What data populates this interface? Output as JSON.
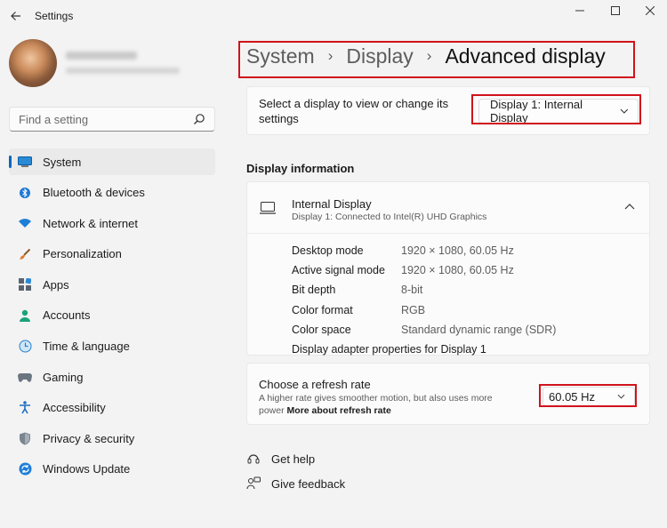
{
  "window": {
    "title": "Settings"
  },
  "search": {
    "placeholder": "Find a setting"
  },
  "sidebar": {
    "items": [
      {
        "label": "System",
        "icon": "system-icon",
        "active": true
      },
      {
        "label": "Bluetooth & devices",
        "icon": "bluetooth-icon"
      },
      {
        "label": "Network & internet",
        "icon": "wifi-icon"
      },
      {
        "label": "Personalization",
        "icon": "brush-icon"
      },
      {
        "label": "Apps",
        "icon": "apps-icon"
      },
      {
        "label": "Accounts",
        "icon": "person-icon"
      },
      {
        "label": "Time & language",
        "icon": "clock-globe-icon"
      },
      {
        "label": "Gaming",
        "icon": "gamepad-icon"
      },
      {
        "label": "Accessibility",
        "icon": "accessibility-icon"
      },
      {
        "label": "Privacy & security",
        "icon": "shield-icon"
      },
      {
        "label": "Windows Update",
        "icon": "update-icon"
      }
    ]
  },
  "breadcrumb": {
    "items": [
      "System",
      "Display"
    ],
    "current": "Advanced display"
  },
  "select_display": {
    "prompt": "Select a display to view or change its settings",
    "value": "Display 1: Internal Display"
  },
  "display_info": {
    "section_title": "Display information",
    "name": "Internal Display",
    "subtitle": "Display 1: Connected to Intel(R) UHD Graphics",
    "rows": [
      {
        "label": "Desktop mode",
        "value": "1920 × 1080, 60.05 Hz"
      },
      {
        "label": "Active signal mode",
        "value": "1920 × 1080, 60.05 Hz"
      },
      {
        "label": "Bit depth",
        "value": "8-bit"
      },
      {
        "label": "Color format",
        "value": "RGB"
      },
      {
        "label": "Color space",
        "value": "Standard dynamic range (SDR)"
      }
    ],
    "adapter_link": "Display adapter properties for Display 1"
  },
  "refresh": {
    "title": "Choose a refresh rate",
    "description": "A higher rate gives smoother motion, but also uses more power",
    "link": "More about refresh rate",
    "value": "60.05 Hz"
  },
  "help": {
    "get_help": "Get help",
    "give_feedback": "Give feedback"
  },
  "colors": {
    "accent": "#0067c0",
    "highlight": "#d0131b"
  }
}
